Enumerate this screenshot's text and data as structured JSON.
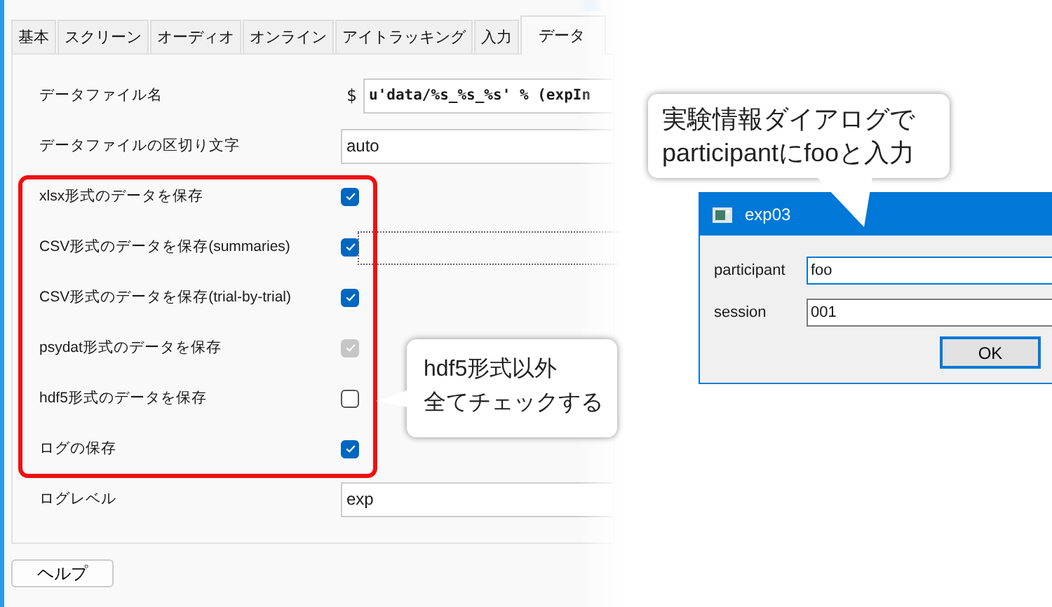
{
  "tabs": [
    {
      "label": "基本",
      "selected": false
    },
    {
      "label": "スクリーン",
      "selected": false
    },
    {
      "label": "オーディオ",
      "selected": false
    },
    {
      "label": "オンライン",
      "selected": false
    },
    {
      "label": "アイトラッキング",
      "selected": false
    },
    {
      "label": "入力",
      "selected": false
    },
    {
      "label": "データ",
      "selected": true
    }
  ],
  "rows": [
    {
      "kind": "code",
      "label": "データファイル名",
      "prefix": "$",
      "value": "u'data/%s_%s_%s' % (expIn"
    },
    {
      "kind": "text",
      "label": "データファイルの区切り文字",
      "value": "auto"
    },
    {
      "kind": "check",
      "label": "xlsx形式のデータを保存",
      "checked": true,
      "disabled": false
    },
    {
      "kind": "check",
      "label": "CSV形式のデータを保存(summaries)",
      "checked": true,
      "disabled": false
    },
    {
      "kind": "check",
      "label": "CSV形式のデータを保存(trial-by-trial)",
      "checked": true,
      "disabled": false
    },
    {
      "kind": "check",
      "label": "psydat形式のデータを保存",
      "checked": true,
      "disabled": true
    },
    {
      "kind": "check",
      "label": "hdf5形式のデータを保存",
      "checked": false,
      "disabled": false
    },
    {
      "kind": "check",
      "label": "ログの保存",
      "checked": true,
      "disabled": false
    },
    {
      "kind": "text",
      "label": "ログレベル",
      "value": "exp"
    }
  ],
  "help_button": "ヘルプ",
  "callouts": [
    {
      "lines": [
        "hdf5形式以外",
        "全てチェックする"
      ]
    },
    {
      "lines": [
        "実験情報ダイアログで",
        "participantにfooと入力"
      ]
    }
  ],
  "dialog": {
    "title": "exp03",
    "fields": [
      {
        "label": "participant",
        "value": "foo",
        "focused": true
      },
      {
        "label": "session",
        "value": "001",
        "focused": false
      }
    ],
    "button": "OK"
  }
}
